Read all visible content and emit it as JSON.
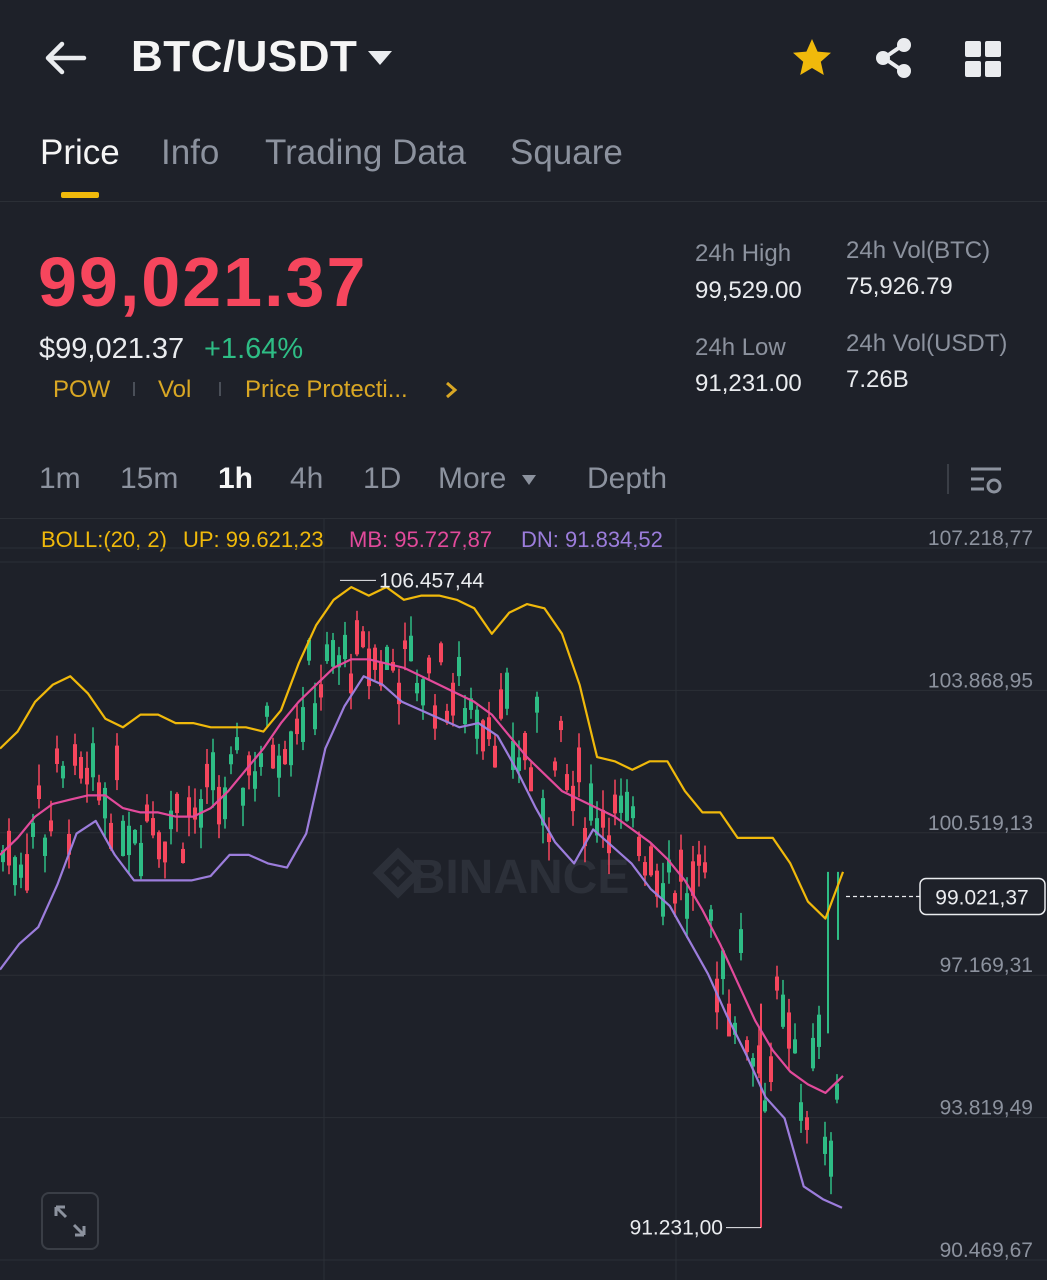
{
  "header": {
    "pair": "BTC/USDT"
  },
  "tabs": [
    "Price",
    "Info",
    "Trading Data",
    "Square"
  ],
  "price": {
    "last": "99,021.37",
    "usd": "$99,021.37",
    "change": "+1.64%",
    "tags": [
      "POW",
      "Vol",
      "Price Protecti..."
    ]
  },
  "stats": {
    "high_label": "24h High",
    "high_value": "99,529.00",
    "low_label": "24h Low",
    "low_value": "91,231.00",
    "vol_btc_label": "24h Vol(BTC)",
    "vol_btc_value": "75,926.79",
    "vol_usdt_label": "24h Vol(USDT)",
    "vol_usdt_value": "7.26B"
  },
  "intervals": [
    "1m",
    "15m",
    "1h",
    "4h",
    "1D",
    "More",
    "Depth"
  ],
  "boll": {
    "label": "BOLL:(20, 2)",
    "up": "UP: 99.621,23",
    "mb": "MB: 95.727,87",
    "dn": "DN: 91.834,52"
  },
  "colors": {
    "up": "#2ebd85",
    "down": "#f6465d",
    "accent": "#f0b90b",
    "boll_up": "#f0b90b",
    "boll_mb": "#e24a9b",
    "boll_dn": "#9c7ddc"
  },
  "chart_data": {
    "type": "candlestick",
    "watermark": "BINANCE",
    "y_ticks": [
      "107.218,77",
      "103.868,95",
      "100.519,13",
      "97.169,31",
      "93.819,49",
      "90.469,67"
    ],
    "ylim": [
      90469.67,
      107218.77
    ],
    "current_price_label": "99.021,37",
    "current_price": 99021.37,
    "max_label": "106.457,44",
    "min_label": "91.231,00",
    "series": [
      {
        "name": "UP",
        "values": [
          102.5,
          102.9,
          103.6,
          104.0,
          104.2,
          103.8,
          103.2,
          103.0,
          103.3,
          103.3,
          103.1,
          103.1,
          103.0,
          103.0,
          103.0,
          102.9,
          103.4,
          104.5,
          105.4,
          106.0,
          106.3,
          106.1,
          106.3,
          106.0,
          106.1,
          106.1,
          106.0,
          105.8,
          105.2,
          105.7,
          105.9,
          105.8,
          105.2,
          104.0,
          102.3,
          102.2,
          102.0,
          102.2,
          102.2,
          101.5,
          101.0,
          101.0,
          100.4,
          100.4,
          100.4,
          99.8,
          98.9,
          98.5,
          99.6
        ]
      },
      {
        "name": "MB",
        "values": [
          100.0,
          100.4,
          100.9,
          101.2,
          101.3,
          101.4,
          101.4,
          101.1,
          101.0,
          101.0,
          100.9,
          100.9,
          101.1,
          101.5,
          102.0,
          102.5,
          103.1,
          103.6,
          104.0,
          104.4,
          104.6,
          104.6,
          104.5,
          104.4,
          104.2,
          104.0,
          103.8,
          103.6,
          103.3,
          102.8,
          102.3,
          101.9,
          101.5,
          101.3,
          101.1,
          100.9,
          100.6,
          100.3,
          99.9,
          99.4,
          98.7,
          97.9,
          97.0,
          96.1,
          95.4,
          94.9,
          94.6,
          94.4,
          94.8
        ]
      },
      {
        "name": "DN",
        "values": [
          97.3,
          97.9,
          98.3,
          99.3,
          100.5,
          100.8,
          100.0,
          99.4,
          99.4,
          99.4,
          99.4,
          99.5,
          100.0,
          100.0,
          99.8,
          99.7,
          100.5,
          102.5,
          103.5,
          104.2,
          104.0,
          103.6,
          103.4,
          103.2,
          103.0,
          103.1,
          102.8,
          102.0,
          101.1,
          100.3,
          99.8,
          100.6,
          100.2,
          99.8,
          99.2,
          98.8,
          98.0,
          97.2,
          96.2,
          95.3,
          94.3,
          93.8,
          92.2,
          91.9,
          91.7
        ]
      }
    ]
  }
}
